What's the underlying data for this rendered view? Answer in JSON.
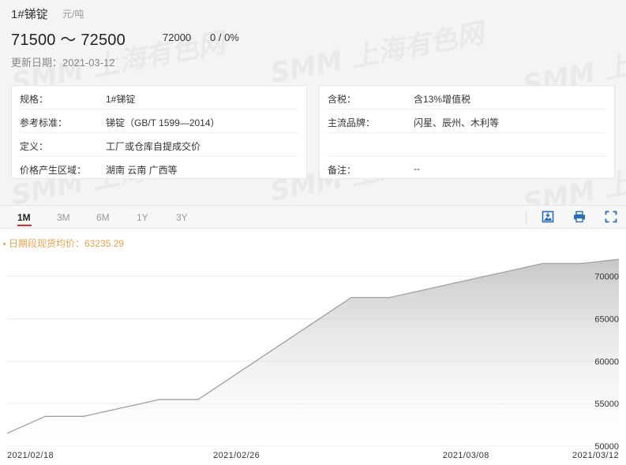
{
  "header": {
    "title": "1#锑锭",
    "unit": "元/吨",
    "price_range": "71500 ～ 72500",
    "average": "72000",
    "change": "0 / 0%",
    "update_date": "更新日期：2021-03-12"
  },
  "info_left": [
    {
      "key": "规格：",
      "value": "1#锑锭"
    },
    {
      "key": "参考标准：",
      "value": "锑锭（GB/T 1599—2014）"
    },
    {
      "key": "定义：",
      "value": "工厂或仓库自提成交价"
    },
    {
      "key": "价格产生区域：",
      "value": "湖南 云南 广西等"
    }
  ],
  "info_right": [
    {
      "key": "含税：",
      "value": "含13%增值税"
    },
    {
      "key": "主流品牌：",
      "value": "闪星、辰州、木利等"
    },
    {
      "key": "",
      "value": ""
    },
    {
      "key": "备注：",
      "value": "--"
    }
  ],
  "tabs": [
    {
      "label": "1M",
      "active": true
    },
    {
      "label": "3M",
      "active": false
    },
    {
      "label": "6M",
      "active": false
    },
    {
      "label": "1Y",
      "active": false
    },
    {
      "label": "3Y",
      "active": false
    }
  ],
  "toolbar": {
    "icons": [
      "save-image-icon",
      "print-icon",
      "fullscreen-icon"
    ]
  },
  "watermark": "SMM 上海有色网",
  "colors": {
    "legend": "#f0a04b",
    "line": "#a0a0a0",
    "active_tab_underline": "#d9322b"
  },
  "chart_data": {
    "type": "area",
    "legend": "日期段现货均价：63235.29",
    "x": [
      "2021/02/18",
      "2021/02/19",
      "2021/02/22",
      "2021/02/23",
      "2021/02/24",
      "2021/02/25",
      "2021/02/26",
      "2021/03/01",
      "2021/03/02",
      "2021/03/03",
      "2021/03/04",
      "2021/03/05",
      "2021/03/08",
      "2021/03/09",
      "2021/03/10",
      "2021/03/11",
      "2021/03/12"
    ],
    "values": [
      51500,
      53500,
      53500,
      54500,
      55500,
      55500,
      58500,
      61500,
      64500,
      67500,
      67500,
      68500,
      69500,
      70500,
      71500,
      71500,
      72000
    ],
    "x_tick_labels": [
      "2021/02/18",
      "2021/02/26",
      "2021/03/08",
      "2021/03/12"
    ],
    "y_ticks": [
      50000,
      55000,
      60000,
      65000,
      70000
    ],
    "ylim": [
      50000,
      72000
    ],
    "grid": "horizontal",
    "y_axis_position": "right"
  }
}
